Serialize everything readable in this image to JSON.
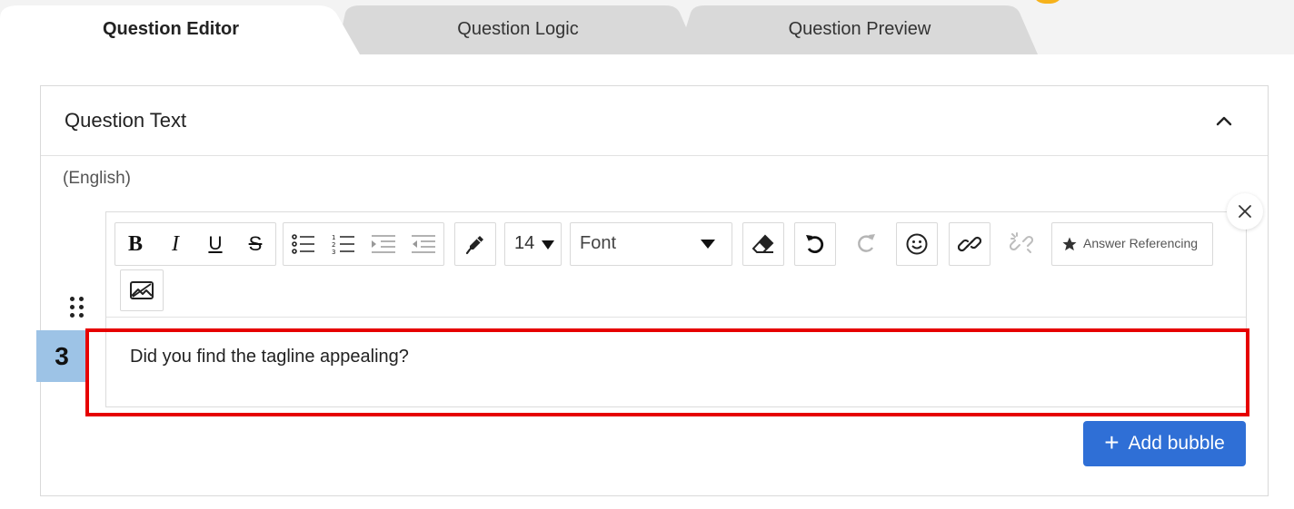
{
  "tabs": [
    {
      "label": "Question Editor",
      "active": true
    },
    {
      "label": "Question Logic",
      "active": false
    },
    {
      "label": "Question Preview",
      "active": false
    }
  ],
  "panel": {
    "title": "Question Text",
    "language": "(English)"
  },
  "toolbar": {
    "bold_label": "B",
    "italic_label": "I",
    "underline_label": "U",
    "strike_label": "S",
    "font_size": "14",
    "font_family": "Font",
    "answer_referencing_label": "Answer Referencing"
  },
  "editor": {
    "content": "Did you find the tagline appealing?"
  },
  "annotation": {
    "step_number": "3",
    "highlight_color": "#e60000",
    "badge_color": "#9dc3e6"
  },
  "actions": {
    "add_bubble_label": "Add bubble",
    "add_bubble_color": "#2f6fd6"
  }
}
